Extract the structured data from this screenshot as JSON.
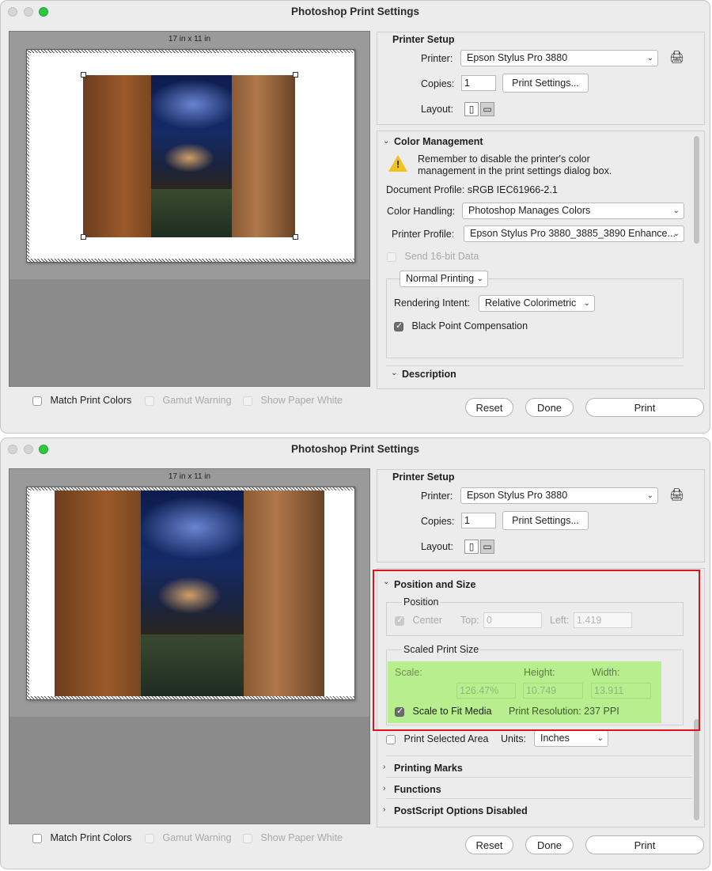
{
  "window_title": "Photoshop Print Settings",
  "preview": {
    "paper_size_label": "17 in x 11 in"
  },
  "bottom_checks": {
    "match_print_colors": "Match Print Colors",
    "gamut_warning": "Gamut Warning",
    "show_paper_white": "Show Paper White"
  },
  "printer_setup": {
    "title": "Printer Setup",
    "printer_label": "Printer:",
    "printer_value": "Epson Stylus Pro 3880",
    "copies_label": "Copies:",
    "copies_value": "1",
    "print_settings_button": "Print Settings...",
    "layout_label": "Layout:"
  },
  "color_management": {
    "title": "Color Management",
    "warning_text_1": "Remember to disable the printer's color",
    "warning_text_2": "management in the print settings dialog box.",
    "document_profile": "Document Profile: sRGB IEC61966-2.1",
    "color_handling_label": "Color Handling:",
    "color_handling_value": "Photoshop Manages Colors",
    "printer_profile_label": "Printer Profile:",
    "printer_profile_value": "Epson Stylus Pro 3880_3885_3890 Enhance...",
    "send_16bit": "Send 16-bit Data",
    "normal_printing": "Normal Printing",
    "rendering_intent_label": "Rendering Intent:",
    "rendering_intent_value": "Relative Colorimetric",
    "black_point": "Black Point Compensation"
  },
  "description_title": "Description",
  "buttons": {
    "reset": "Reset",
    "done": "Done",
    "print": "Print"
  },
  "position_and_size": {
    "title": "Position and Size",
    "position_title": "Position",
    "center": "Center",
    "top_label": "Top:",
    "top_value": "0",
    "left_label": "Left:",
    "left_value": "1.419",
    "scaled_title": "Scaled Print Size",
    "scale_label": "Scale:",
    "height_label": "Height:",
    "width_label": "Width:",
    "scale_value": "126.47%",
    "height_value": "10.749",
    "width_value": "13.911",
    "scale_to_fit": "Scale to Fit Media",
    "print_resolution": "Print Resolution: 237 PPI",
    "highlight_color": "#e0121a",
    "green_color": "#b7ef8e"
  },
  "print_selected_area": "Print Selected Area",
  "units_label": "Units:",
  "units_value": "Inches",
  "sections": {
    "printing_marks": "Printing Marks",
    "functions": "Functions",
    "postscript": "PostScript Options Disabled"
  }
}
